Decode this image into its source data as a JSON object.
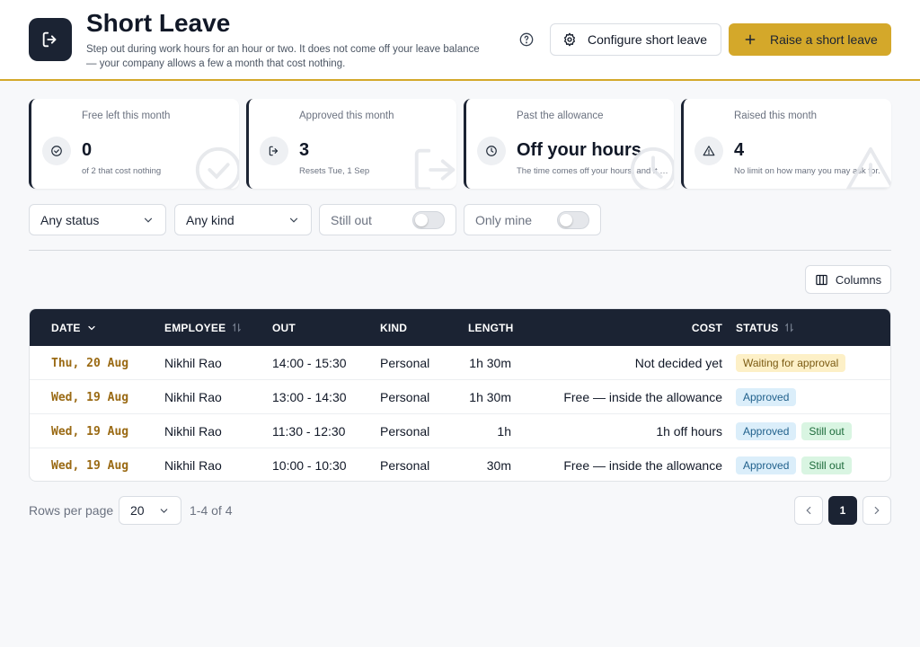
{
  "header": {
    "title": "Short Leave",
    "subtitle": "Step out during work hours for an hour or two. It does not come off your leave balance — your company allows a few a month that cost nothing.",
    "icon": "exit-icon",
    "help_icon": "help-circle-icon",
    "configure_label": "Configure short leave",
    "configure_icon": "gear-icon",
    "raise_label": "Raise a short leave",
    "raise_icon": "plus-icon"
  },
  "stats": [
    {
      "label": "Free left this month",
      "value": "0",
      "sub": "of 2 that cost nothing",
      "icon": "check-circle-icon"
    },
    {
      "label": "Approved this month",
      "value": "3",
      "sub": "Resets Tue, 1 Sep",
      "icon": "exit-icon"
    },
    {
      "label": "Past the allowance",
      "value": "Off your hours",
      "sub": "The time comes off your hours, and it is logged.",
      "icon": "clock-icon"
    },
    {
      "label": "Raised this month",
      "value": "4",
      "sub": "No limit on how many you may ask for.",
      "icon": "warning-icon"
    }
  ],
  "filters": {
    "status": "Any status",
    "kind": "Any kind",
    "still_out": "Still out",
    "only_mine": "Only mine"
  },
  "columns_button": "Columns",
  "table": {
    "headers": {
      "date": "DATE",
      "employee": "EMPLOYEE",
      "out": "OUT",
      "kind": "KIND",
      "length": "LENGTH",
      "cost": "COST",
      "status": "STATUS"
    },
    "rows": [
      {
        "date": "Thu, 20 Aug",
        "employee": "Nikhil Rao",
        "out": "14:00 - 15:30",
        "kind": "Personal",
        "length": "1h 30m",
        "cost": "Not decided yet",
        "status": "Waiting for approval",
        "extra": ""
      },
      {
        "date": "Wed, 19 Aug",
        "employee": "Nikhil Rao",
        "out": "13:00 - 14:30",
        "kind": "Personal",
        "length": "1h 30m",
        "cost": "Free — inside the allowance",
        "status": "Approved",
        "extra": ""
      },
      {
        "date": "Wed, 19 Aug",
        "employee": "Nikhil Rao",
        "out": "11:30 - 12:30",
        "kind": "Personal",
        "length": "1h",
        "cost": "1h off hours",
        "status": "Approved",
        "extra": "Still out"
      },
      {
        "date": "Wed, 19 Aug",
        "employee": "Nikhil Rao",
        "out": "10:00 - 10:30",
        "kind": "Personal",
        "length": "30m",
        "cost": "Free — inside the allowance",
        "status": "Approved",
        "extra": "Still out"
      }
    ]
  },
  "pagination": {
    "rows_label": "Rows per page",
    "rows_value": "20",
    "range": "1-4 of 4",
    "page": "1"
  },
  "colors": {
    "accent": "#d4a82a",
    "dark": "#1b2333",
    "date_text": "#9a6a14"
  }
}
